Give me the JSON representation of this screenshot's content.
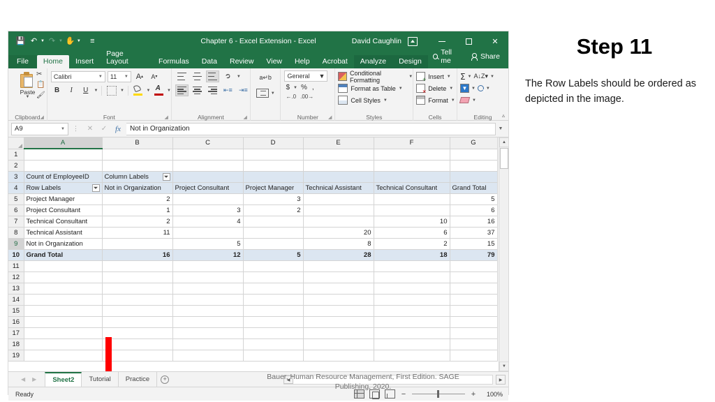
{
  "slide": {
    "step_title": "Step 11",
    "step_body": "The Row Labels should be ordered as depicted in the image.",
    "citation": "Bauer, Human Resource Management, First Edition. SAGE Publishing, 2020."
  },
  "window": {
    "title": "Chapter 6 - Excel Extension  -  Excel",
    "user": "David Caughlin",
    "quick_access": [
      "save-icon",
      "undo-icon",
      "redo-icon",
      "touch-mode-icon",
      "customize-icon"
    ],
    "buttons": {
      "minimize": "—",
      "maximize": "□",
      "close": "✕"
    }
  },
  "tabs": [
    {
      "label": "File",
      "kind": "file"
    },
    {
      "label": "Home",
      "kind": "active"
    },
    {
      "label": "Insert",
      "kind": "normal"
    },
    {
      "label": "Page Layout",
      "kind": "normal"
    },
    {
      "label": "Formulas",
      "kind": "normal"
    },
    {
      "label": "Data",
      "kind": "normal"
    },
    {
      "label": "Review",
      "kind": "normal"
    },
    {
      "label": "View",
      "kind": "normal"
    },
    {
      "label": "Help",
      "kind": "normal"
    },
    {
      "label": "Acrobat",
      "kind": "normal"
    },
    {
      "label": "Analyze",
      "kind": "context"
    },
    {
      "label": "Design",
      "kind": "context"
    }
  ],
  "tab_right": {
    "tell_me": "Tell me",
    "share": "Share"
  },
  "ribbon": {
    "groups": [
      "Clipboard",
      "Font",
      "Alignment",
      "Number",
      "Styles",
      "Cells",
      "Editing"
    ],
    "clipboard": {
      "paste": "Paste"
    },
    "font": {
      "family": "Calibri",
      "size": "11",
      "bold": "B",
      "italic": "I",
      "underline": "U"
    },
    "number": {
      "format": "General",
      "currency": "$",
      "percent": "%",
      "comma": ","
    },
    "styles": {
      "conditional_formatting": "Conditional Formatting",
      "format_as_table": "Format as Table",
      "cell_styles": "Cell Styles"
    },
    "cells": {
      "insert": "Insert",
      "delete": "Delete",
      "format": "Format"
    }
  },
  "formula_bar": {
    "name_box": "A9",
    "cancel": "✕",
    "enter": "✓",
    "fx": "fx",
    "content": "Not in Organization"
  },
  "grid": {
    "columns": [
      "A",
      "B",
      "C",
      "D",
      "E",
      "F",
      "G"
    ],
    "selected_column": "A",
    "selected_row": 9,
    "rows": [
      {
        "n": 1,
        "cells": [
          "",
          "",
          "",
          "",
          "",
          "",
          ""
        ]
      },
      {
        "n": 2,
        "cells": [
          "",
          "",
          "",
          "",
          "",
          "",
          ""
        ]
      },
      {
        "n": 3,
        "cells": [
          "Count of EmployeeID",
          "Column Labels",
          "",
          "",
          "",
          "",
          ""
        ]
      },
      {
        "n": 4,
        "cells": [
          "Row Labels",
          "Not in Organization",
          "Project Consultant",
          "Project Manager",
          "Technical Assistant",
          "Technical Consultant",
          "Grand Total"
        ]
      },
      {
        "n": 5,
        "cells": [
          "Project Manager",
          "2",
          "",
          "3",
          "",
          "",
          "5"
        ]
      },
      {
        "n": 6,
        "cells": [
          "Project Consultant",
          "1",
          "3",
          "2",
          "",
          "",
          "6"
        ]
      },
      {
        "n": 7,
        "cells": [
          "Technical Consultant",
          "2",
          "4",
          "",
          "",
          "10",
          "16"
        ]
      },
      {
        "n": 8,
        "cells": [
          "Technical Assistant",
          "11",
          "",
          "",
          "20",
          "6",
          "37"
        ]
      },
      {
        "n": 9,
        "cells": [
          "Not in Organization",
          "",
          "5",
          "",
          "8",
          "2",
          "15"
        ]
      },
      {
        "n": 10,
        "cells": [
          "Grand Total",
          "16",
          "12",
          "5",
          "28",
          "18",
          "79"
        ]
      },
      {
        "n": 11,
        "cells": [
          "",
          "",
          "",
          "",
          "",
          "",
          ""
        ]
      },
      {
        "n": 12,
        "cells": [
          "",
          "",
          "",
          "",
          "",
          "",
          ""
        ]
      },
      {
        "n": 13,
        "cells": [
          "",
          "",
          "",
          "",
          "",
          "",
          ""
        ]
      },
      {
        "n": 14,
        "cells": [
          "",
          "",
          "",
          "",
          "",
          "",
          ""
        ]
      },
      {
        "n": 15,
        "cells": [
          "",
          "",
          "",
          "",
          "",
          "",
          ""
        ]
      },
      {
        "n": 16,
        "cells": [
          "",
          "",
          "",
          "",
          "",
          "",
          ""
        ]
      },
      {
        "n": 17,
        "cells": [
          "",
          "",
          "",
          "",
          "",
          "",
          ""
        ]
      },
      {
        "n": 18,
        "cells": [
          "",
          "",
          "",
          "",
          "",
          "",
          ""
        ]
      },
      {
        "n": 19,
        "cells": [
          "",
          "",
          "",
          "",
          "",
          "",
          ""
        ]
      }
    ]
  },
  "sheet_tabs": [
    {
      "label": "Sheet2",
      "active": true
    },
    {
      "label": "Tutorial",
      "active": false
    },
    {
      "label": "Practice",
      "active": false
    }
  ],
  "status": {
    "text": "Ready",
    "zoom": "100%"
  },
  "colors": {
    "excel_green": "#217346",
    "pivot_header_blue": "#dce6f1",
    "annotation_red": "#ff0000",
    "selection_green": "#217346"
  }
}
